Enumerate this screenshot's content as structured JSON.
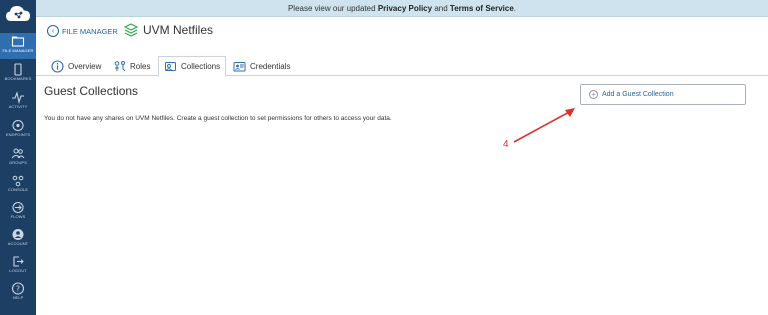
{
  "banner": {
    "prefix": "Please view our updated",
    "privacy": "Privacy Policy",
    "and": "and",
    "terms": "Terms of Service",
    "suffix": "."
  },
  "sidebar": {
    "items": [
      {
        "label": "FILE MANAGER",
        "icon": "folder-icon"
      },
      {
        "label": "BOOKMARKS",
        "icon": "bookmark-icon"
      },
      {
        "label": "ACTIVITY",
        "icon": "activity-icon"
      },
      {
        "label": "ENDPOINTS",
        "icon": "endpoints-icon"
      },
      {
        "label": "GROUPS",
        "icon": "groups-icon"
      },
      {
        "label": "CONSOLE",
        "icon": "console-icon"
      },
      {
        "label": "FLOWS",
        "icon": "flows-icon"
      },
      {
        "label": "ACCOUNT",
        "icon": "account-icon"
      },
      {
        "label": "LOGOUT",
        "icon": "logout-icon"
      },
      {
        "label": "HELP",
        "icon": "help-icon"
      }
    ]
  },
  "header": {
    "file_manager": "FILE MANAGER",
    "endpoint_name": "UVM Netfiles"
  },
  "tabs": [
    {
      "label": "Overview"
    },
    {
      "label": "Roles"
    },
    {
      "label": "Collections"
    },
    {
      "label": "Credentials"
    }
  ],
  "main": {
    "title": "Guest Collections",
    "message": "You do not have any shares on UVM Netfiles. Create a guest collection to set permissions for others to access your data.",
    "add_button": "Add a Guest Collection"
  },
  "annotation": {
    "step": "4",
    "color": "#d9322c"
  }
}
